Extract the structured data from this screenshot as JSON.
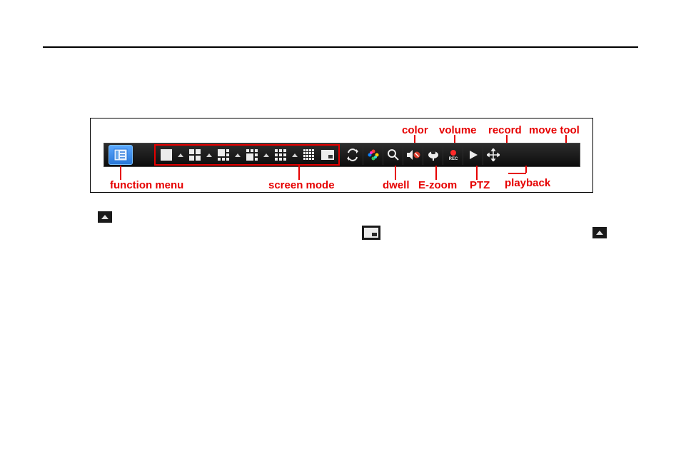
{
  "labels": {
    "color": "color",
    "volume": "volume",
    "record": "record",
    "move_tool": "move tool",
    "function_menu": "function menu",
    "screen_mode": "screen mode",
    "dwell": "dwell",
    "ezoom": "E-zoom",
    "ptz": "PTZ",
    "playback": "playback"
  },
  "icons": {
    "function_menu": "function-menu-icon",
    "screen_1": "single-view-icon",
    "screen_4": "quad-view-icon",
    "screen_6": "six-view-icon",
    "screen_8": "eight-view-icon",
    "screen_9": "nine-view-icon",
    "screen_16": "sixteen-view-icon",
    "pip": "pip-icon",
    "dwell": "dwell-icon",
    "color": "color-icon",
    "ezoom": "zoom-icon",
    "volume": "volume-icon",
    "ptz": "ptz-icon",
    "record": "record-icon",
    "playback": "play-icon",
    "move_tool": "move-tool-icon"
  }
}
